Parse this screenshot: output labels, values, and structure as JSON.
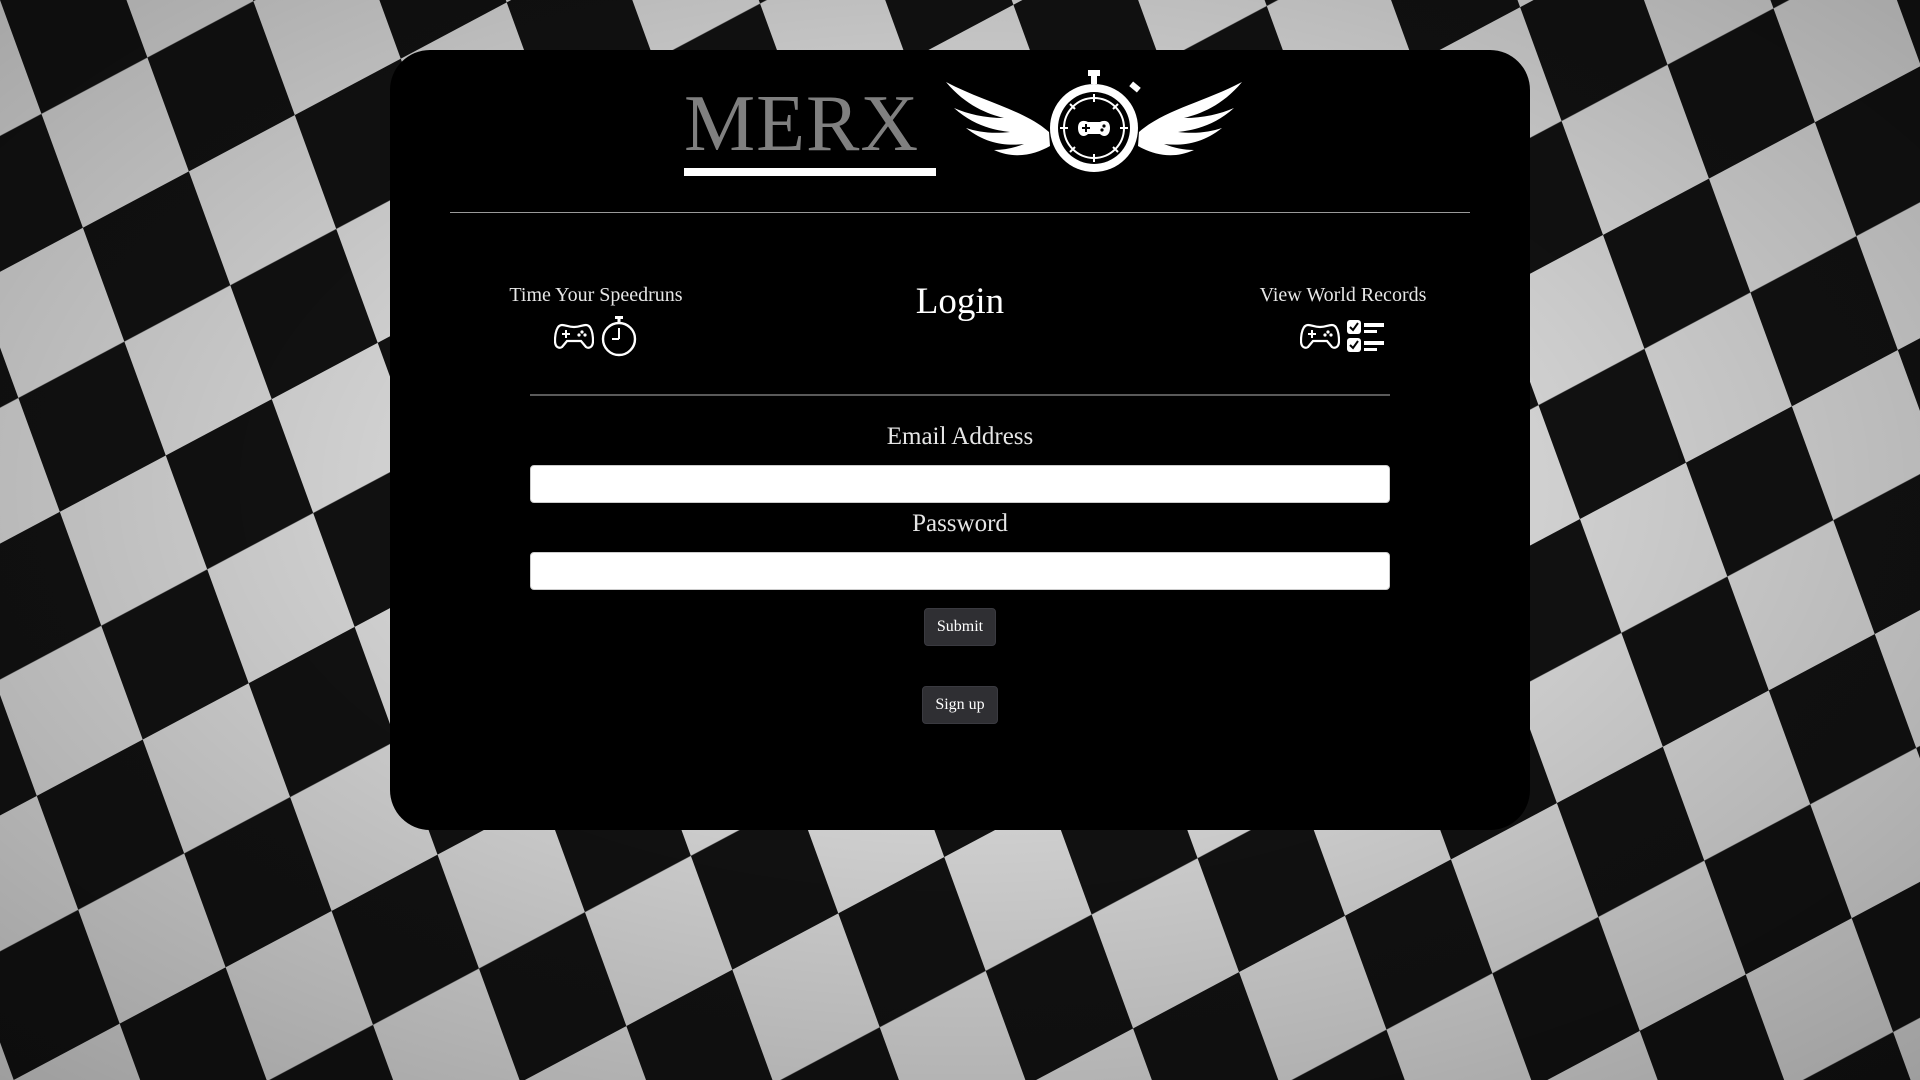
{
  "brand": {
    "name": "MERX"
  },
  "nav": {
    "left": {
      "label": "Time Your Speedruns",
      "icons": [
        "gamepad-icon",
        "stopwatch-icon"
      ]
    },
    "right": {
      "label": "View World Records",
      "icons": [
        "gamepad-icon",
        "checklist-icon"
      ]
    }
  },
  "form": {
    "title": "Login",
    "email_label": "Email Address",
    "email_value": "",
    "password_label": "Password",
    "password_value": "",
    "submit_label": "Submit",
    "signup_label": "Sign up"
  },
  "colors": {
    "card": "#000000",
    "brand_text": "#808080",
    "button": "#2f2f33",
    "text": "#ffffff"
  }
}
